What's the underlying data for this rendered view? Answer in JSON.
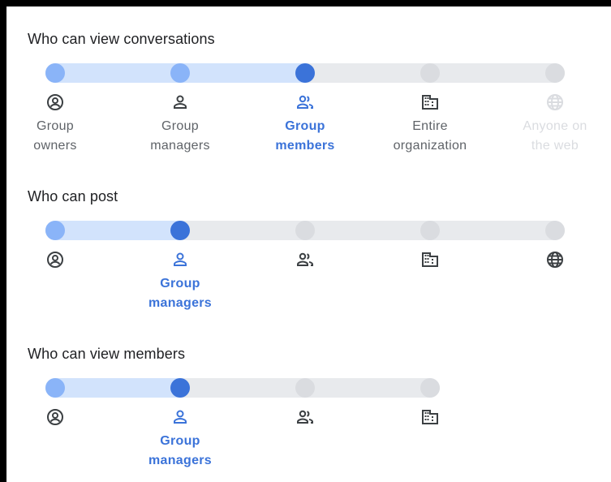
{
  "colors": {
    "accent": "#3b73d9",
    "dot_on": "#8ab4f8",
    "dot_off": "#dadce0",
    "track_fill": "#d2e3fc",
    "track": "#e8eaed"
  },
  "sections": [
    {
      "title": "Who can view conversations",
      "selected": "Group members",
      "options": [
        {
          "icon": "account-circle-icon",
          "label": "Group\nowners",
          "state": "filled"
        },
        {
          "icon": "person-icon",
          "label": "Group\nmanagers",
          "state": "filled"
        },
        {
          "icon": "people-icon",
          "label": "Group\nmembers",
          "state": "selected"
        },
        {
          "icon": "domain-icon",
          "label": "Entire\norganization",
          "state": "available"
        },
        {
          "icon": "globe-icon",
          "label": "Anyone on\nthe web",
          "state": "disabled"
        }
      ]
    },
    {
      "title": "Who can post",
      "selected": "Group managers",
      "options": [
        {
          "icon": "account-circle-icon",
          "label": "",
          "state": "filled"
        },
        {
          "icon": "person-icon",
          "label": "Group\nmanagers",
          "state": "selected"
        },
        {
          "icon": "people-icon",
          "label": "",
          "state": "available"
        },
        {
          "icon": "domain-icon",
          "label": "",
          "state": "available"
        },
        {
          "icon": "globe-icon",
          "label": "",
          "state": "available"
        }
      ]
    },
    {
      "title": "Who can view members",
      "selected": "Group managers",
      "options": [
        {
          "icon": "account-circle-icon",
          "label": "",
          "state": "filled"
        },
        {
          "icon": "person-icon",
          "label": "Group\nmanagers",
          "state": "selected"
        },
        {
          "icon": "people-icon",
          "label": "",
          "state": "available"
        },
        {
          "icon": "domain-icon",
          "label": "",
          "state": "available"
        }
      ]
    }
  ]
}
